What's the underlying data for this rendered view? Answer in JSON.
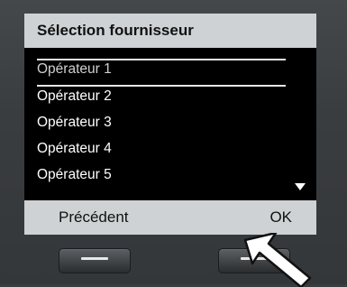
{
  "screen": {
    "title": "Sélection fournisseur",
    "items": [
      {
        "label": "Opérateur 1",
        "selected": true
      },
      {
        "label": "Opérateur 2",
        "selected": false
      },
      {
        "label": "Opérateur 3",
        "selected": false
      },
      {
        "label": "Opérateur 4",
        "selected": false
      },
      {
        "label": "Opérateur 5",
        "selected": false
      }
    ],
    "scroll_indicator_icon": "triangle-down-icon"
  },
  "softkeys": {
    "left_label": "Précédent",
    "right_label": "OK"
  },
  "hardware": {
    "left_key_icon": "dash-icon",
    "right_key_icon": "dash-icon",
    "pointer_icon": "arrow-pointer-icon"
  },
  "colors": {
    "bar_background": "#cfd2d4",
    "screen_background": "#000000",
    "device_body": "#3a3d40"
  }
}
